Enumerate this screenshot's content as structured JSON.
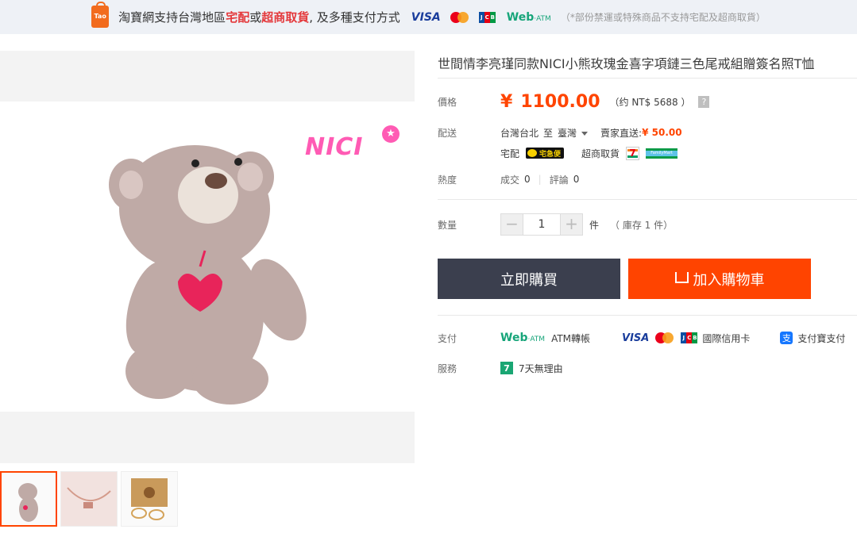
{
  "banner": {
    "icon_label": "Tao",
    "text_pre": "淘寶網支持台灣地區",
    "hl1": "宅配",
    "or": "或",
    "hl2": "超商取貨",
    "text_post": ", 及多種支付方式",
    "visa": "VISA",
    "webatm": "Web",
    "webatm_small": "·ATM",
    "note": "（*部份禁運或特殊商品不支持宅配及超商取貨）"
  },
  "product": {
    "title": "世間情李亮瑾同款NICI小熊玫瑰金喜字項鏈三色尾戒組贈簽名照T恤",
    "brand_logo": "NICI"
  },
  "price": {
    "label": "價格",
    "currency": "¥",
    "value": "1100.00",
    "approx": "（约 NT$ 5688 ）",
    "help": "?"
  },
  "shipping": {
    "label": "配送",
    "from": "台灣台北",
    "to_word": "至",
    "to": "臺灣",
    "seller_direct": "賣家直送:",
    "fee": "¥ 50.00",
    "home_delivery": "宅配",
    "yamato": "宅急便",
    "store_pickup": "超商取貨",
    "seven": "7",
    "familymart": "FamilyMart"
  },
  "popularity": {
    "label": "熱度",
    "sold_label": "成交",
    "sold": "0",
    "reviews_label": "評論",
    "reviews": "0"
  },
  "quantity": {
    "label": "數量",
    "minus": "−",
    "value": "1",
    "plus": "+",
    "unit": "件",
    "stock": "（ 庫存 1 件）"
  },
  "actions": {
    "buy_now": "立即購買",
    "add_cart": "加入購物車"
  },
  "payment": {
    "label": "支付",
    "webatm": "Web",
    "webatm_small": "·ATM",
    "atm_transfer": "ATM轉帳",
    "visa": "VISA",
    "credit_card": "國際信用卡",
    "alipay": "支付寶支付"
  },
  "service": {
    "label": "服務",
    "badge": "7",
    "text": "7天無理由"
  },
  "colors": {
    "accent": "#ff4400",
    "buy_button": "#3b3f4e",
    "price": "#ff4400"
  }
}
